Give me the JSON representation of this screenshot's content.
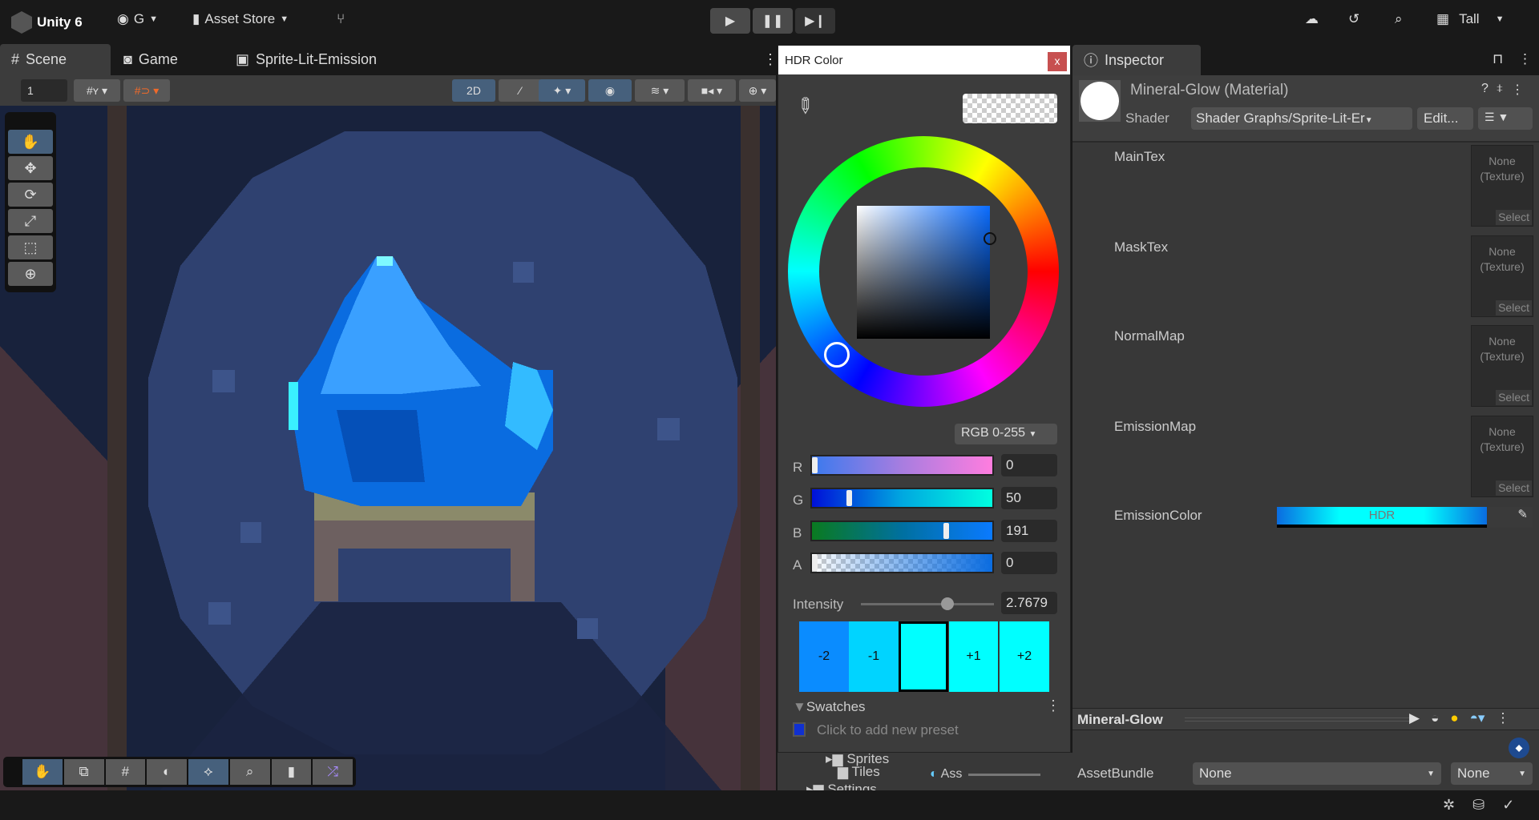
{
  "topbar": {
    "app": "Unity 6",
    "account": "G",
    "asset_store": "Asset Store",
    "layout": "Tall"
  },
  "tabs": [
    {
      "label": "Scene"
    },
    {
      "label": "Game"
    },
    {
      "label": "Sprite-Lit-Emission"
    }
  ],
  "scene_toolbar": {
    "grid_value": "1",
    "mode_2d": "2D"
  },
  "hdr_color": {
    "title": "HDR Color",
    "close": "x",
    "mode": "RGB 0-255",
    "channels": [
      {
        "label": "R",
        "value": "0",
        "fraction": 0
      },
      {
        "label": "G",
        "value": "50",
        "fraction": 0.196
      },
      {
        "label": "B",
        "value": "191",
        "fraction": 0.749
      },
      {
        "label": "A",
        "value": "0",
        "fraction": 0
      }
    ],
    "intensity_label": "Intensity",
    "intensity_value": "2.7679",
    "intensity_fraction": 0.65,
    "stops": [
      "-2",
      "-1",
      "",
      "+1",
      "+2"
    ],
    "stop_colors": [
      "#0a8cff",
      "#00d4ff",
      "#00ffff",
      "#00ffff",
      "#00ffff"
    ],
    "swatches_label": "Swatches",
    "add_preset": "Click to add new preset"
  },
  "project": {
    "items": [
      "Sprites",
      "Tiles",
      "Settings"
    ],
    "search": "Ass"
  },
  "inspector": {
    "tab": "Inspector",
    "title": "Mineral-Glow (Material)",
    "shader_label": "Shader",
    "shader_value": "Shader Graphs/Sprite-Lit-Er",
    "edit": "Edit...",
    "properties": [
      {
        "name": "MainTex",
        "value": "None",
        "type": "(Texture)",
        "select": "Select"
      },
      {
        "name": "MaskTex",
        "value": "None",
        "type": "(Texture)",
        "select": "Select"
      },
      {
        "name": "NormalMap",
        "value": "None",
        "type": "(Texture)",
        "select": "Select"
      },
      {
        "name": "EmissionMap",
        "value": "None",
        "type": "(Texture)",
        "select": "Select"
      }
    ],
    "emission_label": "EmissionColor",
    "emission_tag": "HDR",
    "preview_name": "Mineral-Glow",
    "assetbundle_label": "AssetBundle",
    "assetbundle_value": "None",
    "assetbundle_variant": "None"
  }
}
